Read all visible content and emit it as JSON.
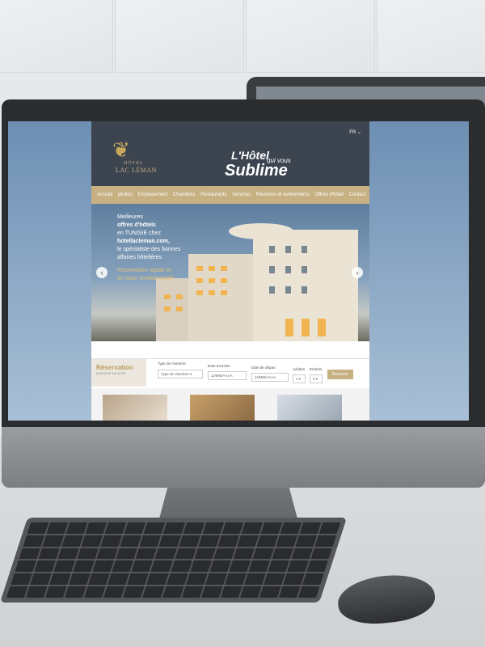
{
  "site": {
    "logo": {
      "line1": "HÔTEL",
      "line2": "LAC LÉMAN"
    },
    "lang": "FR ⌄",
    "tagline": {
      "line1": "L'Hôtel",
      "line2": "qui vous",
      "line3": "Sublime"
    },
    "nav": [
      "Accueil",
      "photos",
      "Emplacement",
      "Chambres",
      "Restaurants",
      "Services",
      "Réunions et événements",
      "Offres d'hôtel",
      "Contact"
    ],
    "hero": {
      "t1": "Meilleures",
      "t2": "offres d'hôtels",
      "t3": "en TUNISIE chez",
      "t4": "hotellacleman.com,",
      "t5": "le spécialiste des bonnes",
      "t6": "affaires hôtelières",
      "promo1": "Reservation rapide et",
      "promo2": "en toute confidentialité"
    },
    "reservation": {
      "title": "Réservation",
      "subtitle": "paiement sécurisé",
      "room_type_label": "Type de chambre",
      "room_type_value": "Type de chambre ▾",
      "arrival_label": "Date d'arrivée",
      "arrival_value": "JJ/MM/AAAA",
      "departure_label": "Date de départ",
      "departure_value": "JJ/MM/AAAA",
      "adults_label": "Adultes",
      "adults_value": "1 ▾",
      "children_label": "Enfants",
      "children_value": "0 ▾",
      "button": "Reserver"
    }
  },
  "colors": {
    "accent": "#c7b082",
    "header": "#3c4450"
  }
}
